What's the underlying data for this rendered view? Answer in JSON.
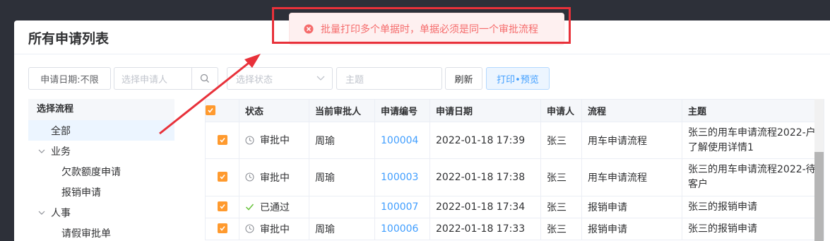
{
  "page": {
    "title": "所有申请列表"
  },
  "toolbar": {
    "date_filter_label": "申请日期:不限",
    "applicant_placeholder": "选择申请人",
    "status_placeholder": "选择状态",
    "subject_placeholder": "主题",
    "refresh_label": "刷新",
    "print_preview_label": "打印•预览"
  },
  "tree": {
    "header": "选择流程",
    "nodes": [
      {
        "label": "全部",
        "level": 1,
        "selected": true
      },
      {
        "label": "业务",
        "level": 1,
        "expandable": true
      },
      {
        "label": "欠款额度申请",
        "level": 2
      },
      {
        "label": "报销申请",
        "level": 2
      },
      {
        "label": "人事",
        "level": 1,
        "expandable": true
      },
      {
        "label": "请假审批单",
        "level": 2
      }
    ]
  },
  "table": {
    "headers": [
      "状态",
      "当前审批人",
      "申请编号",
      "申请日期",
      "申请人",
      "流程",
      "主题"
    ],
    "rows": [
      {
        "status": "审批中",
        "status_icon": "clock-icon",
        "approver": "周瑜",
        "number": "100004",
        "date": "2022-01-18 17:39",
        "applicant": "张三",
        "flow": "用车申请流程",
        "subject": "张三的用车申请流程2022-户了解使用详情1"
      },
      {
        "status": "审批中",
        "status_icon": "clock-icon",
        "approver": "周瑜",
        "number": "100003",
        "date": "2022-01-18 17:38",
        "applicant": "张三",
        "flow": "用车申请流程",
        "subject": "张三的用车申请流程2022-待客户"
      },
      {
        "status": "已通过",
        "status_icon": "check-icon",
        "approver": "",
        "number": "100007",
        "date": "2022-01-18 17:34",
        "applicant": "张三",
        "flow": "报销申请",
        "subject": "张三的报销申请"
      },
      {
        "status": "审批中",
        "status_icon": "clock-icon",
        "approver": "周瑜",
        "number": "100006",
        "date": "2022-01-18 17:33",
        "applicant": "张三",
        "flow": "报销申请",
        "subject": "张三的报销申请"
      }
    ]
  },
  "toast": {
    "message": "批量打印多个单据时，单据必须是同一个审批流程",
    "type": "error"
  },
  "colors": {
    "accent": "#409eff",
    "checkbox": "#ff9a2e",
    "error": "#f56c6c",
    "annotation": "#e8313a"
  },
  "icons": [
    "search-icon",
    "chevron-down-icon",
    "clock-icon",
    "check-icon",
    "error-circle-icon",
    "checkmark-icon"
  ]
}
